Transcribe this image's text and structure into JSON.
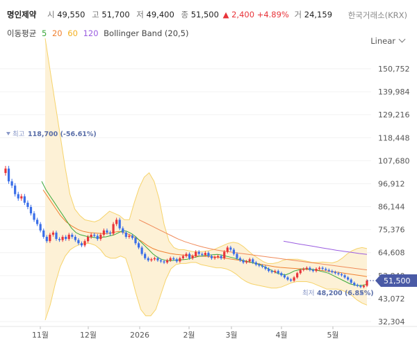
{
  "header": {
    "name": "명인제약",
    "open_label": "시",
    "open": "49,550",
    "high_label": "고",
    "high": "51,700",
    "low_label": "저",
    "low": "49,400",
    "close_label": "종",
    "close": "51,500",
    "change": "▲ 2,400",
    "change_pct": "+4.89%",
    "volume_label": "거",
    "volume": "24,159",
    "exchange": "한국거래소(KRX)"
  },
  "indicators": {
    "ma_label": "이동평균",
    "ma_periods": [
      {
        "period": "5",
        "color": "#3aa83a"
      },
      {
        "period": "20",
        "color": "#f08030"
      },
      {
        "period": "60",
        "color": "#f4b020"
      },
      {
        "period": "120",
        "color": "#9a5ce0"
      }
    ],
    "bb_label": "Bollinger Band (20,5)"
  },
  "scale": {
    "label": "Linear"
  },
  "chart_data": {
    "type": "line",
    "y_axis_ticks": [
      "150,752",
      "139,984",
      "129,216",
      "118,448",
      "107,680",
      "96,912",
      "86,144",
      "75,376",
      "64,608",
      "53,840",
      "43,072",
      "32,304"
    ],
    "ylim": [
      32304,
      150752
    ],
    "x_axis_ticks": [
      "11월",
      "12월",
      "2026",
      "2월",
      "3월",
      "4월",
      "5월"
    ],
    "annotations": {
      "high_label": "최고",
      "high_value": "118,700 (-56.61%)",
      "low_label": "최저",
      "low_value": "48,200 (6.85%)",
      "last_price": "51,500"
    },
    "colors": {
      "up": "#e8343a",
      "down": "#3a6ee8",
      "band_fill": "#fdf1d6",
      "band_line": "#f6d36a",
      "last_badge": "#4a5aa6"
    },
    "series": [
      {
        "name": "price",
        "values": [
          104000,
          98000,
          96000,
          92000,
          90000,
          91000,
          88000,
          86000,
          83000,
          80000,
          78000,
          75000,
          72000,
          70000,
          73000,
          74000,
          71000,
          70500,
          72000,
          71000,
          73000,
          72000,
          70500,
          69000,
          68000,
          70000,
          72000,
          73000,
          72500,
          71000,
          73000,
          75000,
          74000,
          73500,
          78000,
          80000,
          76000,
          74000,
          72000,
          72500,
          71500,
          69000,
          67000,
          64000,
          62000,
          61000,
          61500,
          62000,
          61000,
          60500,
          60000,
          61000,
          62000,
          61500,
          60500,
          62000,
          63000,
          64000,
          62000,
          63000,
          65000,
          64000,
          63500,
          64500,
          63000,
          62000,
          62500,
          63000,
          62000,
          65000,
          67000,
          66000,
          64000,
          62000,
          61000,
          60000,
          60500,
          61500,
          60000,
          59000,
          58500,
          58000,
          57000,
          56000,
          55500,
          56000,
          55000,
          54000,
          53000,
          52000,
          51500,
          53000,
          55000,
          56500,
          57000,
          57500,
          56500,
          56000,
          57000,
          57500,
          57000,
          56500,
          56000,
          55500,
          55000,
          54500,
          54000,
          53000,
          52000,
          50500,
          49500,
          49000,
          48500,
          49100,
          51500
        ]
      },
      {
        "name": "ma5",
        "values": [
          98000,
          94000,
          91000,
          88000,
          85000,
          82000,
          79000,
          76000,
          74000,
          73000,
          72500,
          72000,
          71800,
          71500,
          71800,
          72000,
          72500,
          73000,
          74000,
          75000,
          74500,
          73500,
          72000,
          70000,
          68000,
          66000,
          64000,
          62500,
          61500,
          61000,
          60800,
          61000,
          61200,
          61300,
          61500,
          62000,
          62500,
          63000,
          63200,
          63400,
          63600,
          63800,
          63500,
          63000,
          62500,
          62000,
          61500,
          61000,
          60500,
          60000,
          59500,
          59000,
          58000,
          57000,
          56000,
          55000,
          54500,
          54200,
          55000,
          56000,
          56500,
          57000,
          57000,
          56800,
          56500,
          56000,
          55500,
          55000,
          54000,
          53000,
          52000,
          51000,
          50000,
          49500,
          49200,
          49300,
          49800
        ]
      },
      {
        "name": "ma20",
        "values": [
          94000,
          90000,
          86000,
          82000,
          79000,
          77000,
          75500,
          74500,
          74000,
          73800,
          73600,
          73500,
          74000,
          74500,
          74000,
          73000,
          71500,
          70000,
          68000,
          66500,
          65500,
          64800,
          64200,
          63800,
          63500,
          63300,
          63100,
          63000,
          62900,
          62700,
          62500,
          62200,
          61800,
          61400,
          61000,
          60500,
          60000,
          59500,
          59000,
          58500,
          58000,
          57700,
          57500,
          57300,
          57100,
          56900,
          56700,
          56500,
          56300,
          56000,
          55700,
          55400,
          55000,
          54600,
          54200,
          53800,
          53400
        ]
      },
      {
        "name": "ma60",
        "values": [
          80000,
          78500,
          77000,
          75500,
          74000,
          72500,
          71000,
          69800,
          68800,
          67900,
          67100,
          66400,
          65800,
          65300,
          64900,
          64500,
          64100,
          63700,
          63300,
          62900,
          62500,
          62100,
          61700,
          61300,
          60900,
          60500,
          60100,
          59700,
          59300,
          58900,
          58500,
          58100,
          57700,
          57300,
          56900,
          56500
        ]
      },
      {
        "name": "ma120",
        "values": [
          70000,
          69300,
          68700,
          68100,
          67500,
          66900,
          66300,
          65700,
          65200,
          64700,
          64200,
          63800
        ]
      },
      {
        "name": "bb_upper",
        "values": [
          165000,
          150000,
          135000,
          120000,
          105000,
          92000,
          85000,
          82000,
          80000,
          79500,
          79000,
          80000,
          82000,
          84000,
          83000,
          82000,
          80000,
          80000,
          88000,
          95000,
          100000,
          102000,
          98000,
          90000,
          78000,
          70000,
          67000,
          66000,
          66000,
          65500,
          65000,
          65000,
          65200,
          65500,
          66000,
          67000,
          68000,
          69000,
          69500,
          69000,
          67500,
          65500,
          63500,
          62000,
          60500,
          59500,
          59500,
          60000,
          61000,
          61500,
          61500,
          61500,
          61000,
          60500,
          60000,
          60000,
          60200,
          60000,
          59800,
          60500,
          62000,
          64000,
          65500,
          66500,
          67000,
          66500
        ]
      },
      {
        "name": "bb_lower",
        "values": [
          33000,
          40000,
          50000,
          58000,
          63000,
          66000,
          67500,
          68500,
          69000,
          68800,
          68000,
          66000,
          63000,
          62000,
          62000,
          63000,
          62000,
          55000,
          46000,
          38000,
          35000,
          35000,
          38000,
          45000,
          52000,
          57000,
          59000,
          59500,
          59500,
          60000,
          60000,
          59000,
          58500,
          58000,
          57500,
          57500,
          57000,
          56000,
          54500,
          52500,
          51000,
          50000,
          49500,
          49000,
          48500,
          48000,
          48000,
          48500,
          49500,
          50500,
          51000,
          51000,
          51000,
          50500,
          49500,
          48500,
          47500,
          47500,
          47500,
          47000,
          46000,
          44500,
          42500,
          41000,
          40000
        ]
      }
    ]
  }
}
